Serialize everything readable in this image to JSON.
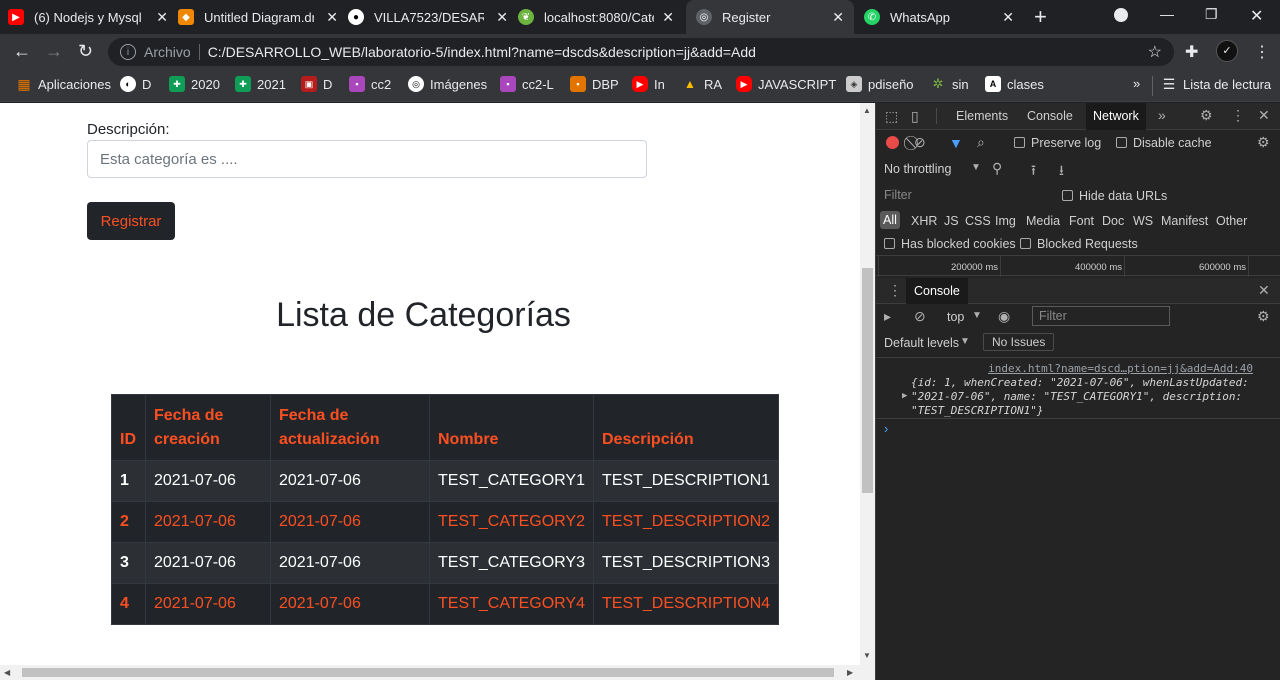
{
  "tabs": [
    {
      "title": "(6) Nodejs y Mysql I",
      "icon": "youtube-icon",
      "color": "#ff0000"
    },
    {
      "title": "Untitled Diagram.dr",
      "icon": "drawio-icon",
      "color": "#f08705"
    },
    {
      "title": "VILLA7523/DESARR",
      "icon": "github-icon",
      "color": "#ffffff"
    },
    {
      "title": "localhost:8080/Cate",
      "icon": "spring-icon",
      "color": "#6db33f"
    },
    {
      "title": "Register",
      "icon": "globe-icon",
      "color": "#9aa0a6"
    },
    {
      "title": "WhatsApp",
      "icon": "whatsapp-icon",
      "color": "#25d366"
    }
  ],
  "toolbar": {
    "scheme": "Archivo",
    "url": "C:/DESARROLLO_WEB/laboratorio-5/index.html?name=dscds&description=jj&add=Add"
  },
  "bookmarks": [
    {
      "label": "Aplicaciones",
      "color": "#e37400"
    },
    {
      "label": "D",
      "color": "#ffffff"
    },
    {
      "label": "2020",
      "color": "#0f9d58"
    },
    {
      "label": "2021",
      "color": "#0f9d58"
    },
    {
      "label": "D",
      "color": "#b71c1c"
    },
    {
      "label": "cc2",
      "color": "#ab47bc"
    },
    {
      "label": "Imágenes",
      "color": "#ffffff"
    },
    {
      "label": "cc2-L",
      "color": "#ab47bc"
    },
    {
      "label": "DBP",
      "color": "#e37400"
    },
    {
      "label": "In",
      "color": "#ff0000"
    },
    {
      "label": "RA",
      "color": "#fbbc04"
    },
    {
      "label": "JAVASCRIPT",
      "color": "#ff0000"
    },
    {
      "label": "pdiseño",
      "color": "#cccccc"
    },
    {
      "label": "sin",
      "color": "#7cb342"
    },
    {
      "label": "clases",
      "color": "#ffffff"
    }
  ],
  "bookmarks_more": "»",
  "reading_list": "Lista de lectura",
  "form": {
    "description_label": "Descripción:",
    "description_placeholder": "Esta categoría es ....",
    "submit_label": "Registrar"
  },
  "list_title": "Lista de Categorías",
  "table": {
    "headers": [
      "ID",
      "Fecha de creación",
      "Fecha de actualización",
      "Nombre",
      "Descripción"
    ],
    "rows": [
      [
        "1",
        "2021-07-06",
        "2021-07-06",
        "TEST_CATEGORY1",
        "TEST_DESCRIPTION1"
      ],
      [
        "2",
        "2021-07-06",
        "2021-07-06",
        "TEST_CATEGORY2",
        "TEST_DESCRIPTION2"
      ],
      [
        "3",
        "2021-07-06",
        "2021-07-06",
        "TEST_CATEGORY3",
        "TEST_DESCRIPTION3"
      ],
      [
        "4",
        "2021-07-06",
        "2021-07-06",
        "TEST_CATEGORY4",
        "TEST_DESCRIPTION4"
      ]
    ]
  },
  "devtools": {
    "tabs": [
      "Elements",
      "Console",
      "Network"
    ],
    "active_tab": "Network",
    "preserve_log": "Preserve log",
    "disable_cache": "Disable cache",
    "throttling": "No throttling",
    "filter_placeholder": "Filter",
    "hide_data_urls": "Hide data URLs",
    "types": [
      "All",
      "XHR",
      "JS",
      "CSS",
      "Img",
      "Media",
      "Font",
      "Doc",
      "WS",
      "Manifest",
      "Other"
    ],
    "has_blocked_cookies": "Has blocked cookies",
    "blocked_requests": "Blocked Requests",
    "timeline_ticks": [
      "200000 ms",
      "400000 ms",
      "600000 ms"
    ],
    "console_tab": "Console",
    "context": "top",
    "console_filter": "Filter",
    "default_levels": "Default levels",
    "no_issues": "No Issues",
    "log_source": "index.html?name=dscd…ption=jj&add=Add:40",
    "log_line1": "{id: 1, whenCreated: \"2021-07-06\", whenLastUpdated:",
    "log_line2": "\"2021-07-06\", name: \"TEST_CATEGORY1\", description:",
    "log_line3": "\"TEST_DESCRIPTION1\"}"
  }
}
